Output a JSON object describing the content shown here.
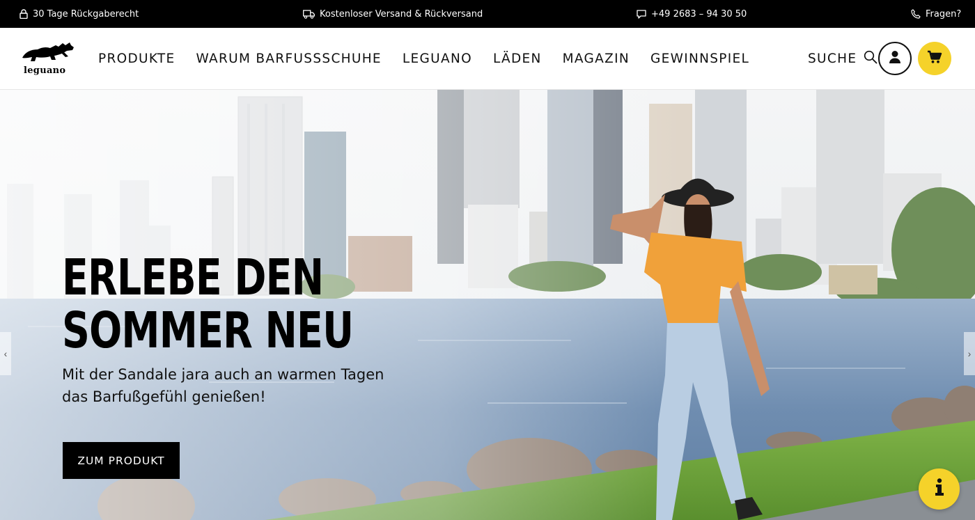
{
  "topbar": {
    "return_policy": "30 Tage Rückgaberecht",
    "shipping": "Kostenloser Versand & Rückversand",
    "phone": "+49 2683 – 94 30 50",
    "questions": "Fragen?"
  },
  "header": {
    "logo_text": "leguano",
    "nav": [
      "PRODUKTE",
      "WARUM BARFUSSSCHUHE",
      "LEGUANO",
      "LÄDEN",
      "MAGAZIN",
      "GEWINNSPIEL"
    ],
    "search_label": "SUCHE",
    "icons": {
      "search": "search-icon",
      "account": "user-icon",
      "cart": "cart-icon"
    },
    "accent_color": "#f5d22a"
  },
  "hero": {
    "title_line1": "ERLEBE DEN",
    "title_line2": "SOMMER NEU",
    "subtitle": "Mit der Sandale jara auch an warmen Tagen das Barfußgefühl genießen!",
    "cta_label": "ZUM PRODUKT",
    "prev_arrow": "‹",
    "next_arrow": "›",
    "info_icon": "info-icon"
  }
}
